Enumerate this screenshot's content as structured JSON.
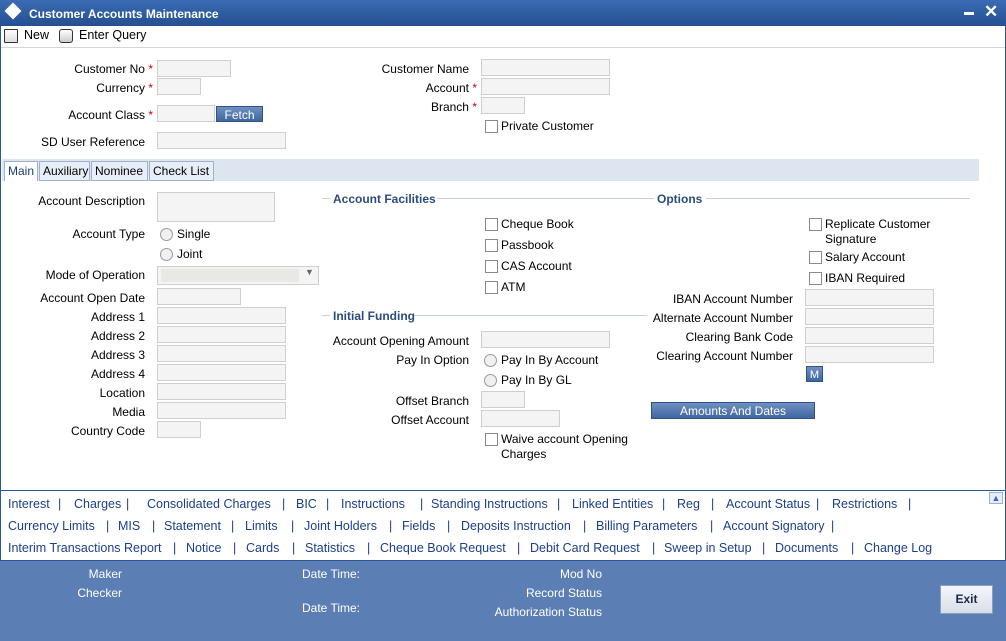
{
  "window": {
    "title": "Customer Accounts Maintenance"
  },
  "toolbar": {
    "new": "New",
    "enter_query": "Enter Query"
  },
  "header": {
    "customer_no": "Customer No",
    "currency": "Currency",
    "account_class": "Account Class",
    "fetch": "Fetch",
    "sd_user_reference": "SD User Reference",
    "customer_name": "Customer Name",
    "account": "Account",
    "branch": "Branch",
    "private_customer": "Private Customer",
    "req": "*"
  },
  "tabs": [
    "Main",
    "Auxiliary",
    "Nominee",
    "Check List"
  ],
  "main": {
    "account_description": "Account Description",
    "account_type": "Account Type",
    "single": "Single",
    "joint": "Joint",
    "mode_of_operation": "Mode of Operation",
    "account_open_date": "Account Open Date",
    "address1": "Address 1",
    "address2": "Address 2",
    "address3": "Address 3",
    "address4": "Address 4",
    "location": "Location",
    "media": "Media",
    "country_code": "Country Code"
  },
  "facilities": {
    "title": "Account Facilities",
    "cheque_book": "Cheque Book",
    "passbook": "Passbook",
    "cas_account": "CAS Account",
    "atm": "ATM"
  },
  "funding": {
    "title": "Initial Funding",
    "opening_amount": "Account Opening Amount",
    "pay_in_option": "Pay In Option",
    "pay_in_account": "Pay In By Account",
    "pay_in_gl": "Pay In By GL",
    "offset_branch": "Offset Branch",
    "offset_account": "Offset Account",
    "waive_1": "Waive account Opening",
    "waive_2": "Charges"
  },
  "options": {
    "title": "Options",
    "replicate_1": "Replicate Customer",
    "replicate_2": "Signature",
    "salary": "Salary Account",
    "iban_required": "IBAN Required",
    "iban_number": "IBAN Account Number",
    "alt_number": "Alternate Account Number",
    "clearing_bank": "Clearing Bank Code",
    "clearing_number": "Clearing Account Number",
    "m": "M",
    "amounts": "Amounts And Dates"
  },
  "links": {
    "row1": [
      "Interest",
      "Charges",
      "Consolidated Charges",
      "BIC",
      "Instructions",
      "Standing Instructions",
      "Linked Entities",
      "Reg",
      "Account Status",
      "Restrictions"
    ],
    "row2": [
      "Currency Limits",
      "MIS",
      "Statement",
      "Limits",
      "Joint Holders",
      "Fields",
      "Deposits Instruction",
      "Billing Parameters",
      "Account Signatory"
    ],
    "row3": [
      "Interim Transactions Report",
      "Notice",
      "Cards",
      "Statistics",
      "Cheque Book Request",
      "Debit Card Request",
      "Sweep in Setup",
      "Documents",
      "Change Log"
    ],
    "sep": "|"
  },
  "footer": {
    "maker": "Maker",
    "checker": "Checker",
    "date_time_1": "Date Time:",
    "date_time_2": "Date Time:",
    "mod_no": "Mod No",
    "record_status": "Record Status",
    "auth_status": "Authorization Status",
    "exit": "Exit"
  }
}
